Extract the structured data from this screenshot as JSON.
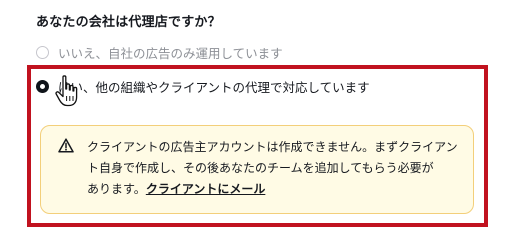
{
  "question": {
    "label": "あなたの会社は代理店ですか？"
  },
  "options": [
    {
      "label": "いいえ、自社の広告のみ運用しています",
      "selected": false
    },
    {
      "label": "はい、他の組織やクライアントの代理で対応しています",
      "selected": true
    }
  ],
  "alert": {
    "icon": "warning-triangle-icon",
    "line_1": "クライアントの広告主アカウントは作成できません。まずクライアン",
    "line_2": "ト自身で作成し、その後あなたのチームを追加してもらう必要が",
    "line_3_prefix": "あります。",
    "link_label": "クライアントにメール",
    "background": "#fffbe5",
    "border": "#f3cf7a"
  },
  "annotation": {
    "highlight_color": "#c1121f"
  },
  "cursor": {
    "icon": "hand-pointer-icon"
  }
}
